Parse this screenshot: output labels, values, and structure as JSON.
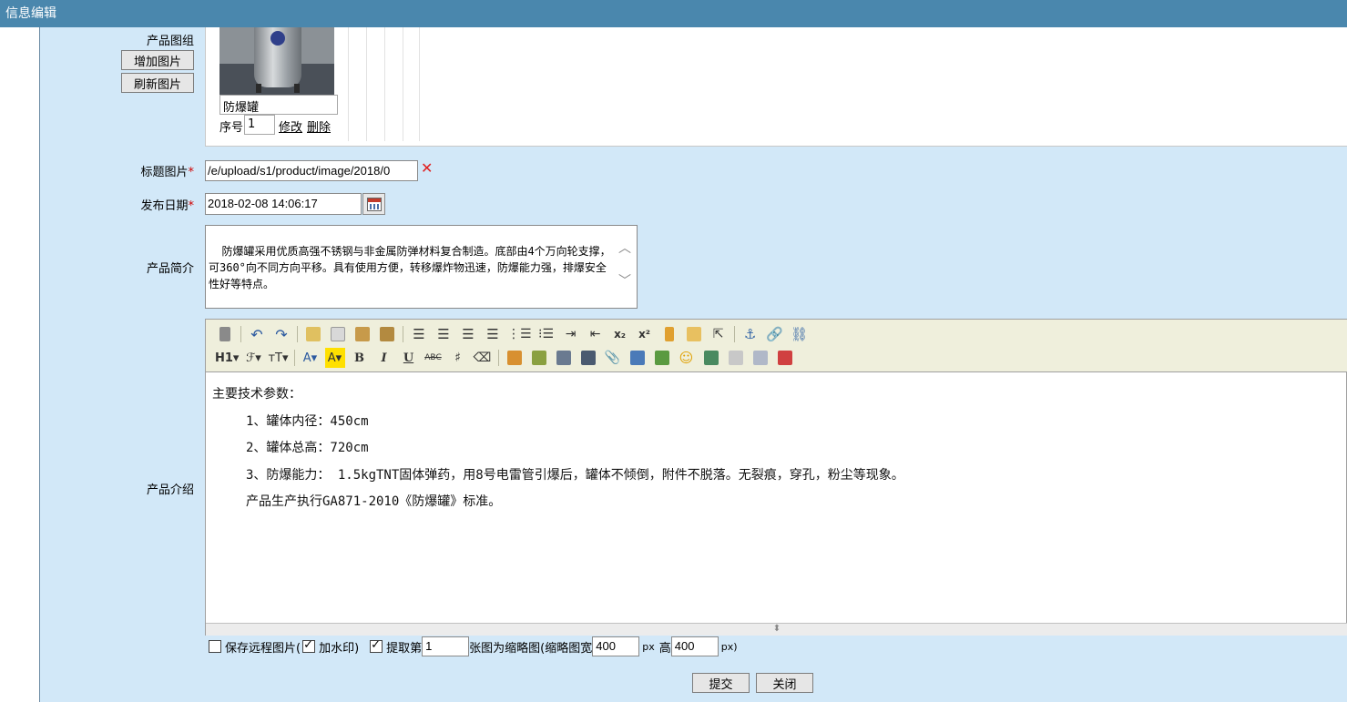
{
  "window": {
    "title": "信息编辑"
  },
  "gallery": {
    "label": "产品图组",
    "add_button": "增加图片",
    "refresh_button": "刷新图片",
    "item": {
      "name": "防爆罐",
      "seq_label": "序号",
      "seq_value": "1",
      "edit_link": "修改",
      "delete_link": "删除"
    }
  },
  "title_image": {
    "label": "标题图片",
    "required_mark": "*",
    "value": "/e/upload/s1/product/image/2018/0"
  },
  "publish_date": {
    "label": "发布日期",
    "required_mark": "*",
    "value": "2018-02-08 14:06:17"
  },
  "summary": {
    "label": "产品简介",
    "value": "防爆罐采用优质高强不锈钢与非金属防弹材料复合制造。底部由4个万向轮支撑，可360°向不同方向平移。具有使用方便，转移爆炸物迅速，防爆能力强，排爆安全性好等特点。"
  },
  "intro": {
    "label": "产品介绍",
    "toolbar_text": {
      "heading": "H1▾",
      "font": "ℱ▾",
      "size": "тT▾",
      "font_color": "A▾",
      "bg_color": "A▾",
      "bold": "B",
      "italic": "I",
      "underline": "U",
      "strike": "ABC"
    },
    "lines": [
      "主要技术参数：",
      "1、罐体内径：450cm",
      "2、罐体总高：720cm",
      "3、防爆能力： 1.5kgTNT固体弹药，用8号电雷管引爆后，罐体不倾倒，附件不脱落。无裂痕，穿孔，粉尘等现象。",
      "产品生产执行GA871-2010《防爆罐》标准。"
    ]
  },
  "options": {
    "save_remote": "保存远程图片(",
    "watermark": "加水印)",
    "extract_prefix": "提取第",
    "extract_index": "1",
    "extract_suffix": "张图为缩略图(缩略图宽",
    "thumb_width": "400",
    "px1": "px",
    "height_label": "高",
    "thumb_height": "400",
    "px2": "px)"
  },
  "actions": {
    "submit": "提交",
    "close": "关闭"
  }
}
